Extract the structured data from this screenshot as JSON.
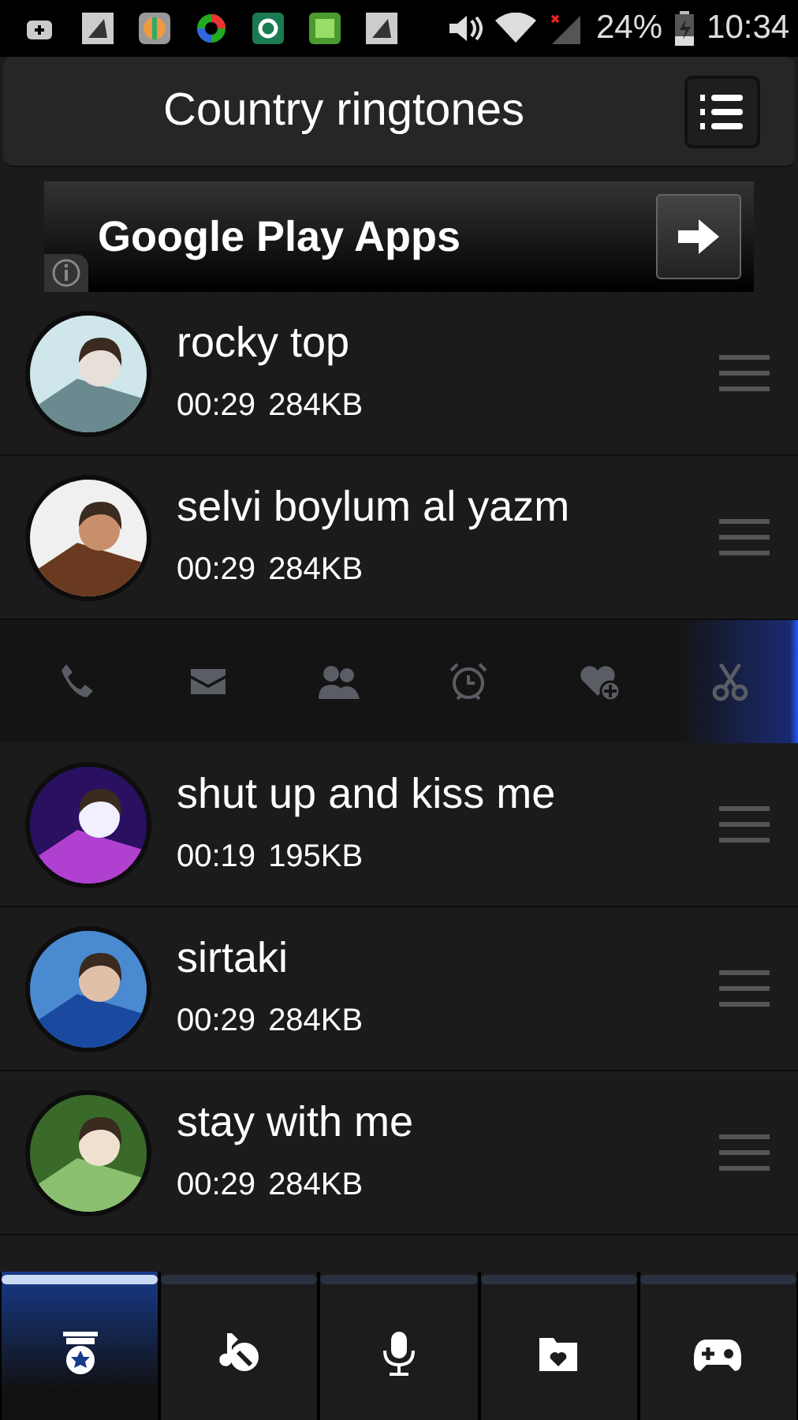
{
  "status_bar": {
    "battery": "24%",
    "time": "10:34"
  },
  "header": {
    "title": "Country ringtones"
  },
  "ad": {
    "text": "Google Play Apps"
  },
  "ringtones": [
    {
      "title": "rocky top",
      "duration": "00:29",
      "size": "284KB",
      "expanded": false
    },
    {
      "title": "selvi boylum al yazm",
      "duration": "00:29",
      "size": "284KB",
      "expanded": true
    },
    {
      "title": "shut up and kiss me",
      "duration": "00:19",
      "size": "195KB",
      "expanded": false
    },
    {
      "title": "sirtaki",
      "duration": "00:29",
      "size": "284KB",
      "expanded": false
    },
    {
      "title": "stay with me",
      "duration": "00:29",
      "size": "284KB",
      "expanded": false
    }
  ],
  "tabs": [
    {
      "kind": "medal",
      "selected": true
    },
    {
      "kind": "music",
      "selected": false
    },
    {
      "kind": "mic",
      "selected": false
    },
    {
      "kind": "folder",
      "selected": false
    },
    {
      "kind": "gamepad",
      "selected": false
    }
  ]
}
